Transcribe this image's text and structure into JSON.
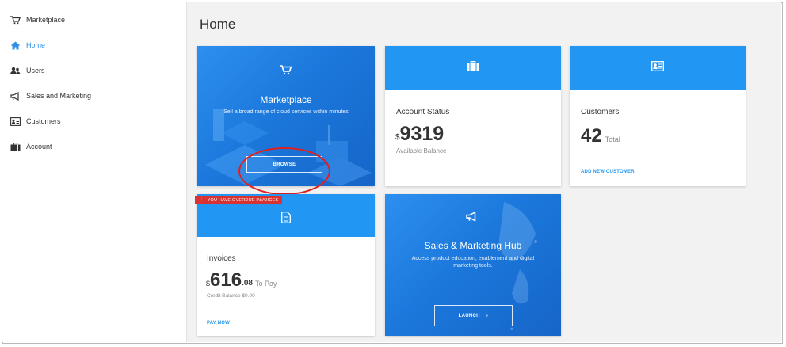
{
  "sidebar": {
    "items": [
      {
        "label": "Marketplace",
        "icon": "cart-icon"
      },
      {
        "label": "Home",
        "icon": "home-icon"
      },
      {
        "label": "Users",
        "icon": "users-icon"
      },
      {
        "label": "Sales and Marketing",
        "icon": "megaphone-icon"
      },
      {
        "label": "Customers",
        "icon": "contact-card-icon"
      },
      {
        "label": "Account",
        "icon": "briefcase-icon"
      }
    ],
    "active_index": 1
  },
  "main": {
    "title": "Home",
    "marketplace": {
      "title": "Marketplace",
      "description": "Sell a broad range of cloud services within minutes",
      "button": "BROWSE"
    },
    "account_status": {
      "title": "Account Status",
      "currency": "$",
      "amount": "9319",
      "sub": "Available Balance"
    },
    "customers": {
      "title": "Customers",
      "count": "42",
      "count_label": "Total",
      "link": "ADD NEW CUSTOMER"
    },
    "invoices": {
      "alert": "YOU HAVE OVERDUE INVOICES",
      "title": "Invoices",
      "currency": "$",
      "amount": "616",
      "cents": ".08",
      "pay_label": "To Pay",
      "credit": "Credit Balance $0.00",
      "link": "PAY NOW"
    },
    "sales_hub": {
      "title": "Sales & Marketing Hub",
      "description": "Access product education, enablement and digital marketing tools.",
      "button": "LAUNCH"
    }
  },
  "colors": {
    "accent": "#2196f3",
    "active_nav": "#2f8fe8",
    "alert": "#d93232",
    "annotation": "#e02020"
  }
}
